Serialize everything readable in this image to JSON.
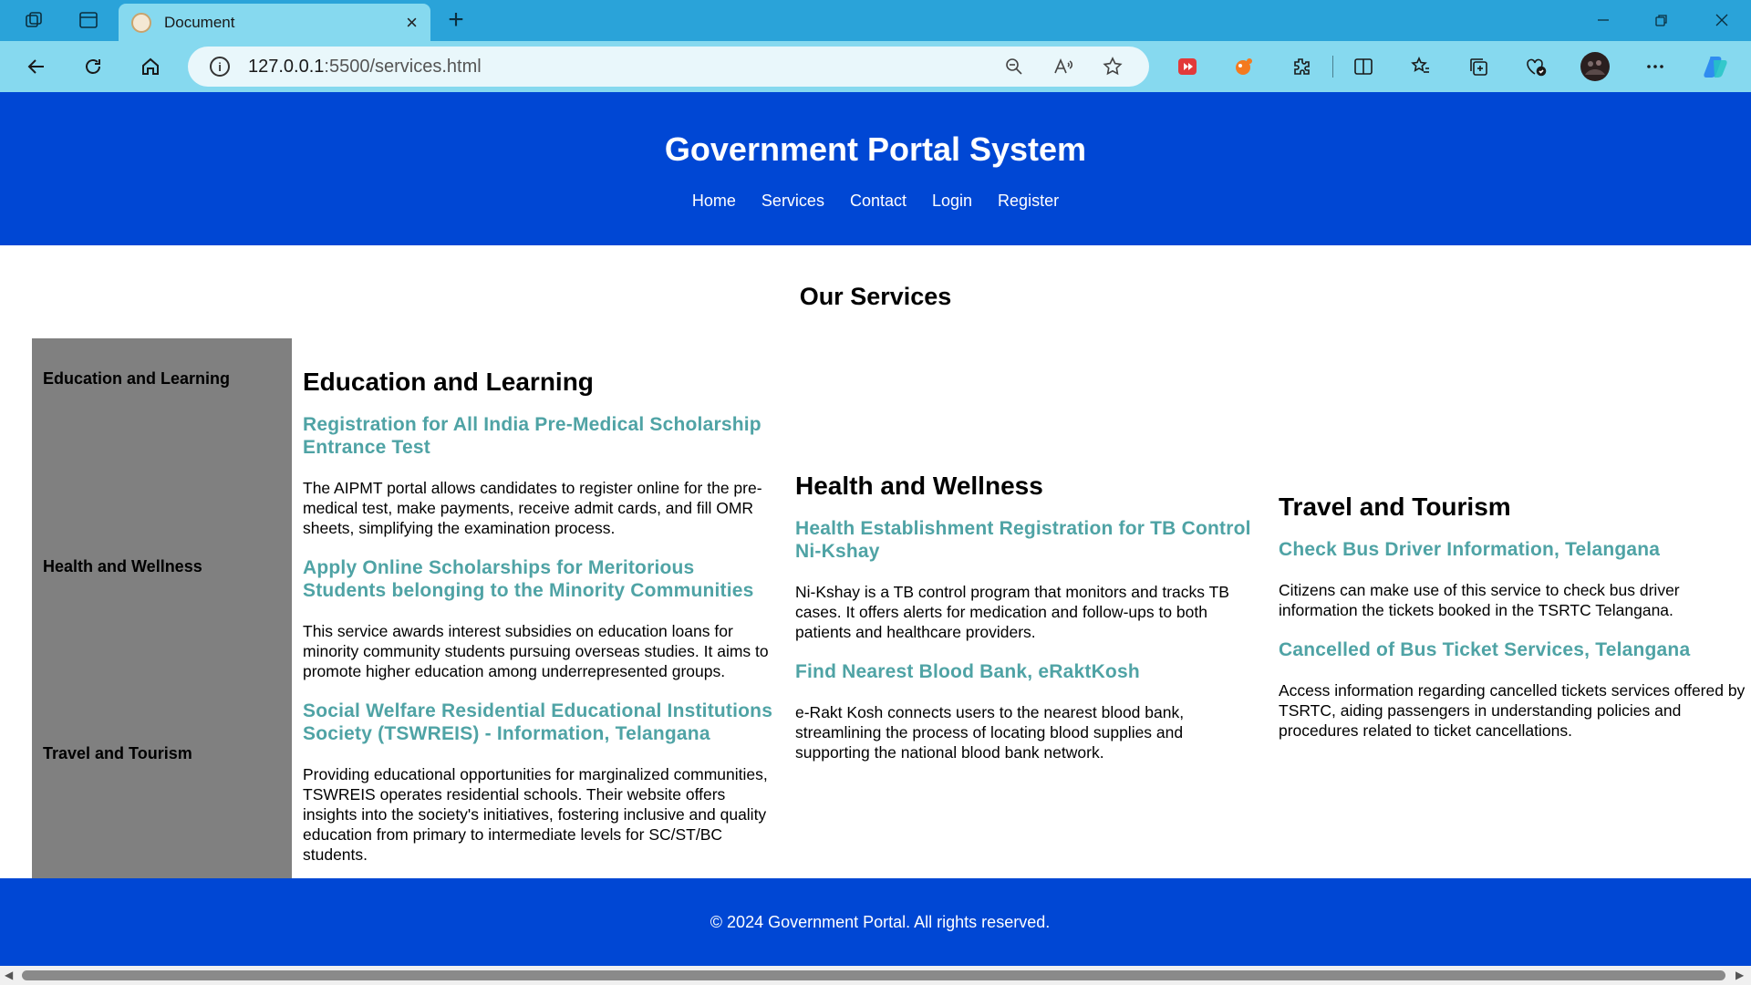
{
  "browser": {
    "tab_title": "Document",
    "url_host": "127.0.0.1",
    "url_path": ":5500/services.html",
    "new_tab_label": "+",
    "close_tab_label": "×"
  },
  "site": {
    "title": "Government Portal System",
    "nav": [
      "Home",
      "Services",
      "Contact",
      "Login",
      "Register"
    ]
  },
  "page": {
    "heading": "Our Services"
  },
  "sidebar": {
    "items": [
      "Education and Learning",
      "Health and Wellness",
      "Travel and Tourism"
    ]
  },
  "sections": {
    "education": {
      "title": "Education and Learning",
      "services": [
        {
          "name": "Registration for All India Pre-Medical Scholarship Entrance Test",
          "desc": "The AIPMT portal allows candidates to register online for the pre-medical test, make payments, receive admit cards, and fill OMR sheets, simplifying the examination process."
        },
        {
          "name": "Apply Online Scholarships for Meritorious Students belonging to the Minority Communities",
          "desc": "This service awards interest subsidies on education loans for minority community students pursuing overseas studies. It aims to promote higher education among underrepresented groups."
        },
        {
          "name": "Social Welfare Residential Educational Institutions Society (TSWREIS) - Information, Telangana",
          "desc": "Providing educational opportunities for marginalized communities, TSWREIS operates residential schools. Their website offers insights into the society's initiatives, fostering inclusive and quality education from primary to intermediate levels for SC/ST/BC students."
        }
      ]
    },
    "health": {
      "title": "Health and Wellness",
      "services": [
        {
          "name": "Health Establishment Registration for TB Control Ni-Kshay",
          "desc": "Ni-Kshay is a TB control program that monitors and tracks TB cases. It offers alerts for medication and follow-ups to both patients and healthcare providers."
        },
        {
          "name": "Find Nearest Blood Bank, eRaktKosh",
          "desc": "e-Rakt Kosh connects users to the nearest blood bank, streamlining the process of locating blood supplies and supporting the national blood bank network."
        }
      ]
    },
    "travel": {
      "title": "Travel and Tourism",
      "services": [
        {
          "name": "Check Bus Driver Information, Telangana",
          "desc": "Citizens can make use of this service to check bus driver information the tickets booked in the TSRTC Telangana."
        },
        {
          "name": "Cancelled of Bus Ticket Services, Telangana",
          "desc": "Access information regarding cancelled tickets services offered by TSRTC, aiding passengers in understanding policies and procedures related to ticket cancellations."
        }
      ]
    }
  },
  "footer": {
    "text": "© 2024 Government Portal. All rights reserved."
  },
  "colors": {
    "header_bg": "#0047d4",
    "link": "#4fa3a5",
    "sidebar_bg": "#808080",
    "tabbar_bg": "#2aa3d9",
    "toolbar_bg": "#86d9ef"
  },
  "icons": {
    "tab_strip": [
      "workspaces-icon",
      "tab-actions-icon"
    ],
    "nav": [
      "back-arrow-icon",
      "refresh-icon",
      "home-icon"
    ],
    "address": [
      "info-icon",
      "zoom-out-icon",
      "read-aloud-icon",
      "favorite-star-icon"
    ],
    "extensions": [
      "video-extension-icon",
      "orange-extension-icon",
      "extensions-puzzle-icon",
      "split-screen-icon",
      "favorites-icon",
      "collections-icon",
      "browser-essentials-icon",
      "profile-avatar-icon",
      "more-options-icon",
      "copilot-icon"
    ]
  }
}
